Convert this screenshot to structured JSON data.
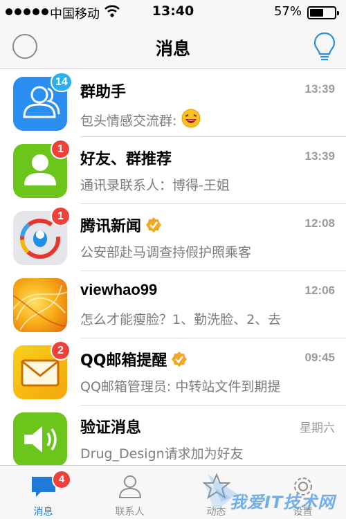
{
  "status_bar": {
    "carrier": "中国移动",
    "time": "13:40",
    "battery_percent_label": "57%",
    "battery_level": 0.57
  },
  "nav": {
    "title": "消息"
  },
  "conversations": [
    {
      "name": "群助手",
      "time": "13:39",
      "preview": "包头情感交流群:",
      "preview_emoji": "😆",
      "badge": "14",
      "badge_color": "#2ab0ee",
      "avatar_icon": "group-people-icon",
      "verified": false
    },
    {
      "name": "好友、群推荐",
      "time": "13:39",
      "preview": "通讯录联系人：博得-王姐",
      "badge": "1",
      "badge_color": "#f0403a",
      "avatar_icon": "person-icon",
      "verified": false
    },
    {
      "name": "腾讯新闻",
      "time": "12:08",
      "preview": "公安部赴马调查持假护照乘客",
      "badge": "1",
      "badge_color": "#f0403a",
      "avatar_icon": "tencent-news-logo",
      "verified": true
    },
    {
      "name": "viewhao99",
      "time": "12:06",
      "preview": "怎么才能瘦脸？1、勤洗脸、2、去",
      "badge": null,
      "avatar_icon": "abstract-orange-avatar",
      "verified": false
    },
    {
      "name": "QQ邮箱提醒",
      "time": "09:45",
      "preview": "QQ邮箱管理员: 中转站文件到期提",
      "badge": "2",
      "badge_color": "#f0403a",
      "avatar_icon": "mail-envelope-icon",
      "verified": true
    },
    {
      "name": "验证消息",
      "time": "星期六",
      "preview": "Drug_Design请求加为好友",
      "badge": null,
      "avatar_icon": "speaker-icon",
      "verified": false
    }
  ],
  "tabs": [
    {
      "label": "消息",
      "badge": "4",
      "active": true
    },
    {
      "label": "联系人",
      "badge": null,
      "active": false
    },
    {
      "label": "动态",
      "badge": null,
      "active": false
    },
    {
      "label": "设置",
      "badge": null,
      "active": false
    }
  ],
  "watermark": "我爱IT技术网",
  "colors": {
    "accent": "#1e7bd8",
    "badge_red": "#f0403a",
    "badge_blue": "#2ab0ee",
    "secondary_text": "#7c7c7c"
  }
}
